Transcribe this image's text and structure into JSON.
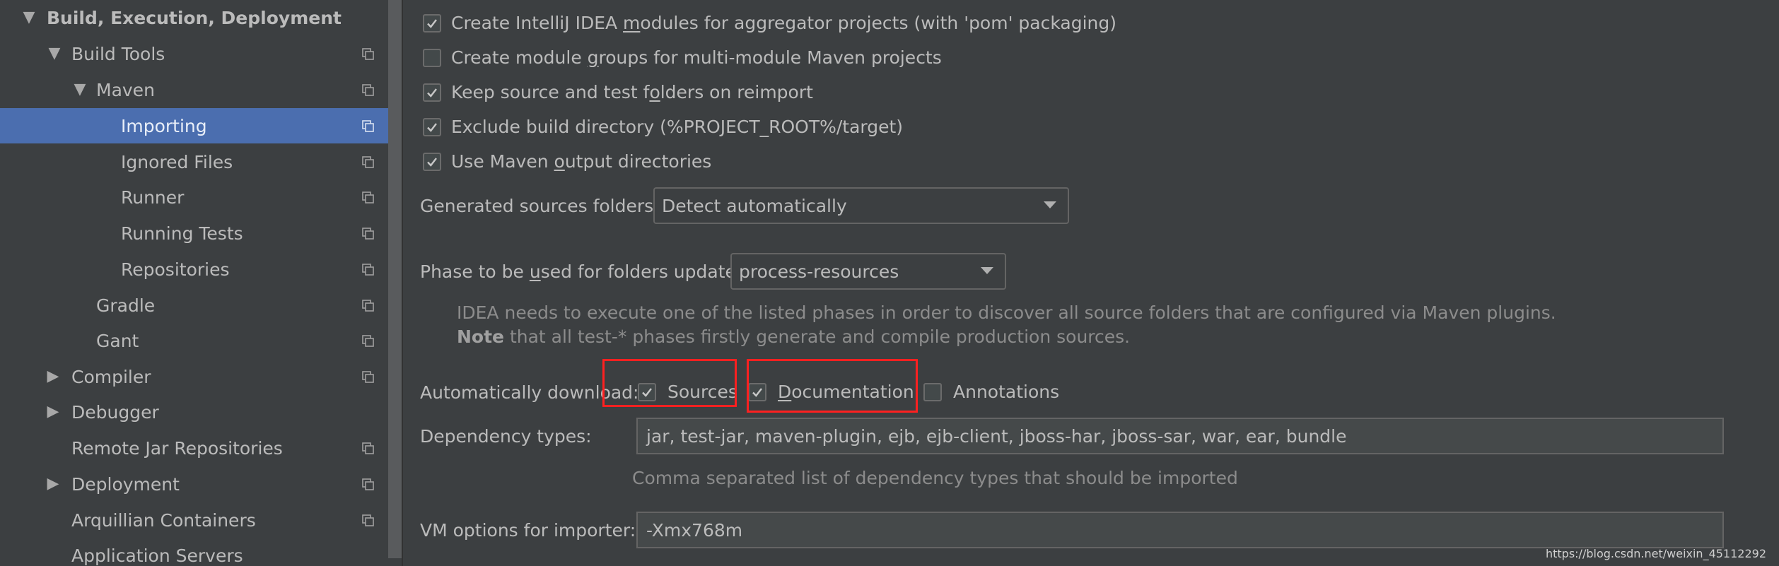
{
  "sidebar": {
    "items": [
      {
        "label": "Build, Execution, Deployment",
        "expanded": true,
        "bold": true
      },
      {
        "label": "Build Tools",
        "expanded": true
      },
      {
        "label": "Maven",
        "expanded": true
      },
      {
        "label": "Importing",
        "selected": true
      },
      {
        "label": "Ignored Files"
      },
      {
        "label": "Runner"
      },
      {
        "label": "Running Tests"
      },
      {
        "label": "Repositories"
      },
      {
        "label": "Gradle"
      },
      {
        "label": "Gant"
      },
      {
        "label": "Compiler",
        "expanded": false
      },
      {
        "label": "Debugger",
        "expanded": false
      },
      {
        "label": "Remote Jar Repositories"
      },
      {
        "label": "Deployment",
        "expanded": false
      },
      {
        "label": "Arquillian Containers"
      },
      {
        "label": "Application Servers"
      }
    ],
    "icons": {
      "expanded": "triangle-down-icon",
      "collapsed": "triangle-right-icon",
      "project_scope": "copy-icon"
    }
  },
  "options": {
    "create_modules": {
      "pre": "Create IntelliJ IDEA ",
      "u": "m",
      "post": "odules for aggregator projects (with 'pom' packaging)",
      "checked": true
    },
    "module_groups": {
      "pre": "Create module ",
      "u": "g",
      "post": "roups for multi-module Maven projects",
      "checked": false
    },
    "keep_folders": {
      "pre": "Keep source and test f",
      "u": "o",
      "post": "lders on reimport",
      "checked": true
    },
    "exclude_build": {
      "pre": "Exclude build directory (%PROJECT_ROOT%/target)",
      "u": "",
      "post": "",
      "checked": true
    },
    "use_output": {
      "pre": "Use Maven ",
      "u": "o",
      "post": "utput directories",
      "checked": true
    }
  },
  "generated_sources": {
    "label": "Generated sources folders:",
    "value": "Detect automatically"
  },
  "phase": {
    "label_pre": "Phase to be ",
    "label_u": "u",
    "label_post": "sed for folders update:",
    "value": "process-resources"
  },
  "phase_hint": {
    "line1": "IDEA needs to execute one of the listed phases in order to discover all source folders that are configured via Maven plugins.",
    "line2_bold": "Note",
    "line2_rest": " that all test-* phases firstly generate and compile production sources."
  },
  "auto_download": {
    "label": "Automatically download:",
    "sources": {
      "label": "Sources",
      "checked": true
    },
    "documentation": {
      "pre": "",
      "u": "D",
      "post": "ocumentation",
      "checked": true
    },
    "annotations": {
      "label": "Annotations",
      "checked": false
    }
  },
  "dependency_types": {
    "label": "Dependency types:",
    "value": "jar, test-jar, maven-plugin, ejb, ejb-client, jboss-har, jboss-sar, war, ear, bundle",
    "hint": "Comma separated list of dependency types that should be imported"
  },
  "vm_options": {
    "label": "VM options for importer:",
    "value": "-Xmx768m"
  },
  "watermark": "https://blog.csdn.net/weixin_45112292",
  "colors": {
    "background": "#3c3f41",
    "selection": "#4b6eaf",
    "text": "#bbbbbb",
    "highlight_box": "#ff2020"
  }
}
